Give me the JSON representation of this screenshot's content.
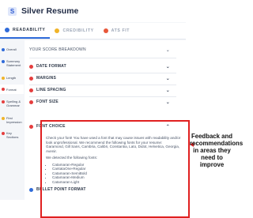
{
  "header": {
    "logo_letter": "S",
    "title": "Silver Resume"
  },
  "tabs": [
    {
      "label": "READABILITY",
      "color": "#2f6bd9",
      "active": true
    },
    {
      "label": "CREDIBILITY",
      "color": "#f0b429",
      "active": false
    },
    {
      "label": "ATS FIT",
      "color": "#e8573a",
      "active": false
    }
  ],
  "sidebar": {
    "items": [
      {
        "label": "Overall",
        "color": "#2f6bd9"
      },
      {
        "label": "Summary Statement",
        "color": "#2f6bd9"
      },
      {
        "label": "Length",
        "color": "#f0b429"
      },
      {
        "label": "Format",
        "color": "#e53e3e"
      },
      {
        "label": "Spelling & Grammar",
        "color": "#e53e3e"
      },
      {
        "label": "First Impression",
        "color": "#f0b429"
      },
      {
        "label": "Key Sections",
        "color": "#e53e3e"
      }
    ]
  },
  "main": {
    "breakdown_label": "YOUR SCORE BREAKDOWN",
    "sections": [
      {
        "label": "DATE FORMAT"
      },
      {
        "label": "MARGINS"
      },
      {
        "label": "LINE SPACING"
      },
      {
        "label": "FONT SIZE"
      }
    ],
    "font_choice": {
      "label": "FONT CHOICE",
      "paragraph": "Check your font! You have used a font that may cause issues with readability and/or look unprofessional. We recommend the following fonts for your resume: Garamond, Gill Sans, Cambria, Calibri, Constantia, Lato, Didot, Helvetica, Georgia, Avenir.",
      "detected_intro": "We detected the following fonts:",
      "fonts": [
        "Catamaran-Regular",
        "CantataOne-Regular",
        "Catamaran-SemiBold",
        "Catamaran-Medium",
        "Catamaran-Light"
      ]
    },
    "bullet_point_format": "BULLET POINT FORMAT"
  },
  "annotation": {
    "text": "Feedback and recommendations in areas they need to improve"
  },
  "colors": {
    "accent": "#2f6bd9",
    "error": "#e53e3e",
    "warning": "#f0b429",
    "highlight": "#e02020"
  }
}
